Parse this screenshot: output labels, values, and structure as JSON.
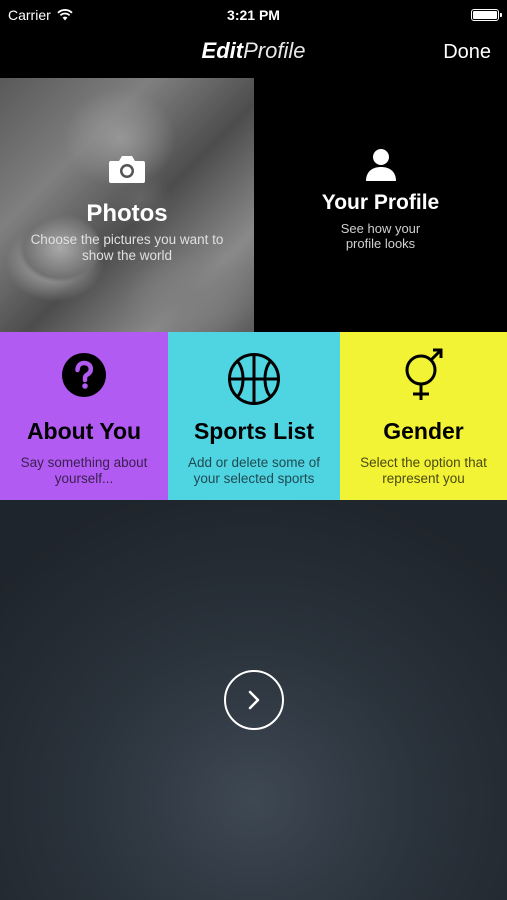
{
  "status_bar": {
    "carrier": "Carrier",
    "time": "3:21 PM",
    "battery_level": 1.0
  },
  "nav": {
    "title_bold": "Edit",
    "title_light": "Profile",
    "done_label": "Done"
  },
  "tiles": {
    "photos": {
      "title": "Photos",
      "subtitle": "Choose the pictures you want to show the world",
      "icon": "camera-icon"
    },
    "profile": {
      "title": "Your Profile",
      "subtitle": "See how your profile looks",
      "icon": "person-icon"
    },
    "about": {
      "title": "About You",
      "subtitle": "Say something  about yourself...",
      "icon": "question-icon",
      "color": "#b15bf2"
    },
    "sports": {
      "title": "Sports List",
      "subtitle": "Add or delete some of your selected sports",
      "icon": "basketball-icon",
      "color": "#4fd4e2"
    },
    "gender": {
      "title": "Gender",
      "subtitle": "Select the option that represent you",
      "icon": "gender-icon",
      "color": "#f3f335"
    }
  },
  "next_button": {
    "icon": "chevron-right-icon"
  }
}
